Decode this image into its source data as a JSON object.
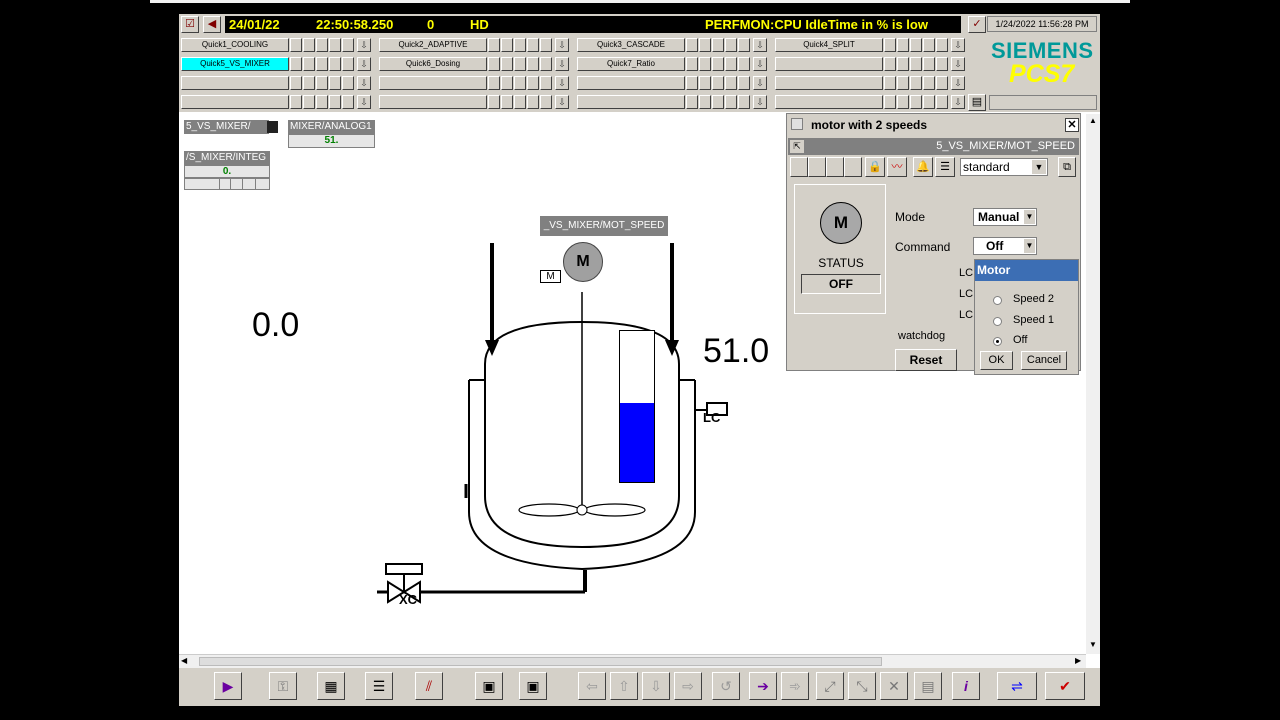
{
  "header": {
    "date": "24/01/22",
    "time": "22:50:58.250",
    "count": "0",
    "hd": "HD",
    "message": "PERFMON:CPU IdleTime in % is low",
    "clock": "1/24/2022 11:56:28 PM"
  },
  "quick": {
    "row1": [
      "Quick1_COOLING",
      "Quick2_ADAPTIVE",
      "Quick3_CASCADE",
      "Quick4_SPLIT"
    ],
    "row2": [
      "Quick5_VS_MIXER",
      "Quick6_Dosing",
      "Quick7_Ratio",
      ""
    ]
  },
  "brand": {
    "name": "SIEMENS",
    "product": "PCS7"
  },
  "faceplates": {
    "fp1_tag": "5_VS_MIXER/",
    "fp2_tag": "MIXER/ANALOG1",
    "fp2_value": "51.",
    "fp3_tag": "/S_MIXER/INTEG",
    "fp3_value": "0."
  },
  "process": {
    "motor_tag": "_VS_MIXER/MOT_SPEED",
    "motor_symbol": "M",
    "motor_small": "M",
    "left_value": "0.0",
    "right_value": "51.0",
    "lc_label": "LC",
    "xc_label": "XC",
    "level_fraction": 0.52
  },
  "dialog": {
    "title": "motor with 2 speeds",
    "tag": "5_VS_MIXER/MOT_SPEED",
    "view_select": "standard",
    "motor_symbol": "M",
    "status_label": "STATUS",
    "status_value": "OFF",
    "mode_label": "Mode",
    "mode_value": "Manual",
    "command_label": "Command",
    "command_value": "Off",
    "lc_partial": [
      "LC",
      "LC",
      "LC"
    ],
    "watchdog_label": "watchdog",
    "reset_label": "Reset"
  },
  "motor_popup": {
    "title": "Motor",
    "options": [
      "Speed 2",
      "Speed 1",
      "Off"
    ],
    "selected": "Off",
    "ok_label": "OK",
    "cancel_label": "Cancel"
  }
}
